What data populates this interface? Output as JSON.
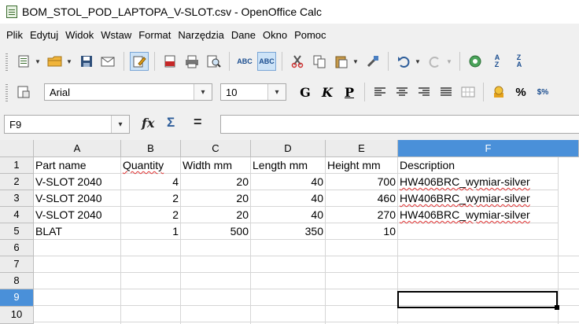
{
  "window": {
    "title": "BOM_STOL_POD_LAPTOPA_V-SLOT.csv - OpenOffice Calc"
  },
  "menu": [
    "Plik",
    "Edytuj",
    "Widok",
    "Wstaw",
    "Format",
    "Narzędzia",
    "Dane",
    "Okno",
    "Pomoc"
  ],
  "format_bar": {
    "font_name": "Arial",
    "font_size": "10",
    "bold_label": "G",
    "italic_label": "K",
    "underline_label": "P",
    "percent_label": "%"
  },
  "formula_bar": {
    "name_box": "F9",
    "function_wizard_label": "fx",
    "sum_label": "Σ",
    "equals_label": "=",
    "input_value": ""
  },
  "sheet": {
    "columns": [
      "A",
      "B",
      "C",
      "D",
      "E",
      "F"
    ],
    "rows": [
      "1",
      "2",
      "3",
      "4",
      "5",
      "6",
      "7",
      "8",
      "9",
      "10"
    ],
    "selected_cell": "F9",
    "cells": [
      [
        "Part name",
        "Quantity",
        "Width mm",
        "Length mm",
        "Height mm",
        "Description"
      ],
      [
        "V-SLOT 2040",
        "4",
        "20",
        "40",
        "700",
        "HW406BRC_wymiar-silver"
      ],
      [
        "V-SLOT 2040",
        "2",
        "20",
        "40",
        "460",
        "HW406BRC_wymiar-silver"
      ],
      [
        "V-SLOT 2040",
        "2",
        "20",
        "40",
        "270",
        "HW406BRC_wymiar-silver"
      ],
      [
        "BLAT",
        "1",
        "500",
        "350",
        "10",
        ""
      ]
    ]
  },
  "colors": {
    "selection": "#4a90d9",
    "toolbar_bg": "#f0f0f0",
    "header_bg": "#ececec"
  }
}
